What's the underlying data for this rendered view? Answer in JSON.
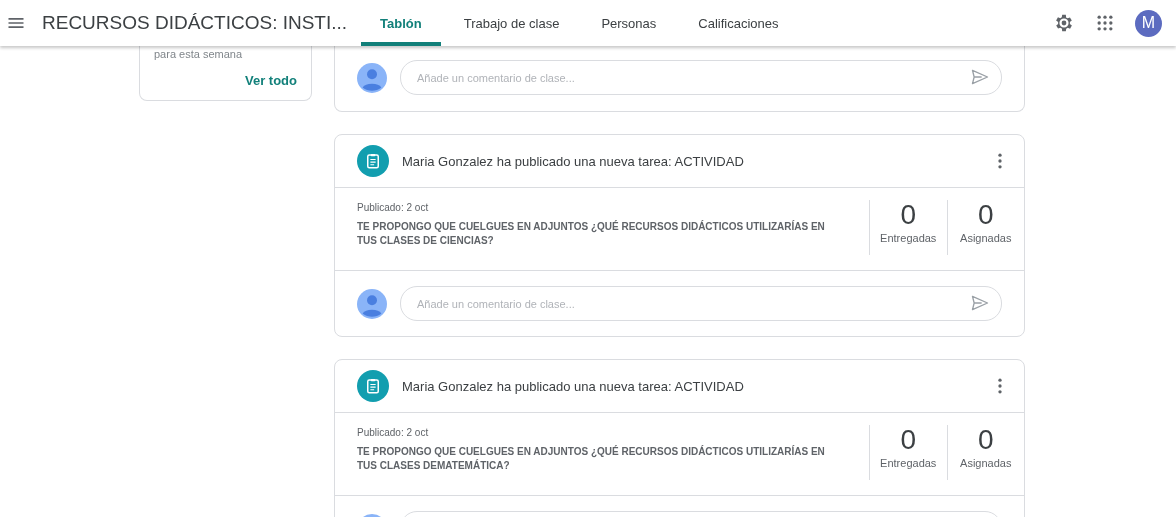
{
  "header": {
    "title": "RECURSOS DIDÁCTICOS: INSTI...",
    "tabs": [
      {
        "label": "Tablón",
        "selected": true
      },
      {
        "label": "Trabajo de clase",
        "selected": false
      },
      {
        "label": "Personas",
        "selected": false
      },
      {
        "label": "Calificaciones",
        "selected": false
      }
    ],
    "account_initial": "M"
  },
  "upcoming": {
    "text": "para esta semana",
    "link": "Ver todo"
  },
  "stream": [
    {
      "kind": "comment_only",
      "comment": {
        "placeholder": "Añade un comentario de clase..."
      }
    },
    {
      "kind": "assignment",
      "title": "Maria Gonzalez ha publicado una nueva tarea: ACTIVIDAD",
      "published": "Publicado: 2 oct",
      "description": "TE PROPONGO QUE CUELGUES EN ADJUNTOS ¿QUÉ RECURSOS DIDÁCTICOS  UTILIZARÍAS EN TUS CLASES DE CIENCIAS?",
      "stats": [
        {
          "value": "0",
          "label": "Entregadas"
        },
        {
          "value": "0",
          "label": "Asignadas"
        }
      ],
      "comment": {
        "placeholder": "Añade un comentario de clase..."
      }
    },
    {
      "kind": "assignment",
      "title": "Maria Gonzalez ha publicado una nueva tarea: ACTIVIDAD",
      "published": "Publicado: 2 oct",
      "description": "TE PROPONGO QUE CUELGUES EN ADJUNTOS ¿QUÉ RECURSOS DIDÁCTICOS  UTILIZARÍAS EN TUS CLASES DEMATEMÁTICA?",
      "stats": [
        {
          "value": "0",
          "label": "Entregadas"
        },
        {
          "value": "0",
          "label": "Asignadas"
        }
      ]
    }
  ]
}
